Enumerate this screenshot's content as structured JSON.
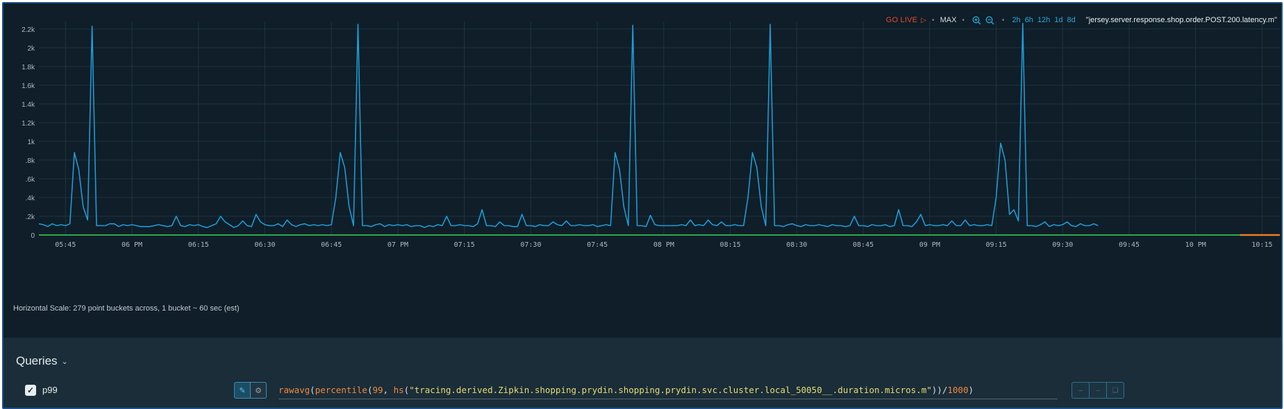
{
  "toolbar": {
    "go_live": "GO LIVE",
    "max": "MAX",
    "zoom_in_icon": "zoom-in-icon",
    "zoom_out_icon": "zoom-out-icon",
    "ranges": [
      "2h",
      "6h",
      "12h",
      "1d",
      "8d"
    ],
    "metric_name": "\"jersey.server.response.shop.order.POST.200.latency.m\""
  },
  "scale_text": "Horizontal Scale: 279 point buckets across, 1 bucket ~ 60 sec (est)",
  "queries": {
    "title": "Queries",
    "row": {
      "checked": true,
      "name": "p99",
      "parts": [
        {
          "t": "rawavg",
          "c": "fn"
        },
        {
          "t": "(",
          "c": "punct"
        },
        {
          "t": "percentile",
          "c": "fn"
        },
        {
          "t": "(",
          "c": "punct"
        },
        {
          "t": "99",
          "c": "num"
        },
        {
          "t": ", ",
          "c": "punct"
        },
        {
          "t": "hs",
          "c": "fn"
        },
        {
          "t": "(",
          "c": "punct"
        },
        {
          "t": "\"tracing.derived.Zipkin.shopping.prydin.shopping.prydin.svc.cluster.local_50050__.duration.micros.m\"",
          "c": "str"
        },
        {
          "t": "))",
          "c": "punct"
        },
        {
          "t": "/",
          "c": "op"
        },
        {
          "t": "1000",
          "c": "num"
        },
        {
          "t": ")",
          "c": "punct"
        }
      ]
    }
  },
  "colors": {
    "background": "#0f1e28",
    "series": "#1f9ad6",
    "zero_line": "#2ea84a",
    "future_marker": "#f07a22",
    "go_live": "#e5492f",
    "accent": "#26a8d8"
  },
  "chart_data": {
    "type": "line",
    "title": "",
    "xlabel": "",
    "ylabel": "",
    "x_tick_labels": [
      "05:45",
      "06 PM",
      "06:15",
      "06:30",
      "06:45",
      "07 PM",
      "07:15",
      "07:30",
      "07:45",
      "08 PM",
      "08:15",
      "08:30",
      "08:45",
      "09 PM",
      "09:15",
      "09:30",
      "09:45",
      "10 PM",
      "10:15"
    ],
    "x_tick_minutes": [
      345,
      360,
      375,
      390,
      405,
      420,
      435,
      450,
      465,
      480,
      495,
      510,
      525,
      540,
      555,
      570,
      585,
      600,
      615
    ],
    "xlim_minutes": [
      339,
      619
    ],
    "y_tick_labels": [
      "0",
      ".2k",
      ".4k",
      ".6k",
      ".8k",
      "1k",
      "1.2k",
      "1.4k",
      "1.6k",
      "1.8k",
      "2k",
      "2.2k"
    ],
    "y_ticks": [
      0,
      200,
      400,
      600,
      800,
      1000,
      1200,
      1400,
      1600,
      1800,
      2000,
      2200
    ],
    "ylim": [
      0,
      2280
    ],
    "grid": true,
    "baseline_value": 0,
    "future_marker_minutes": [
      610,
      619
    ],
    "series": [
      {
        "x_minutes": [
          339,
          340,
          341,
          342,
          343,
          344,
          345,
          346,
          347,
          348,
          349,
          350,
          351,
          352,
          353,
          354,
          355,
          356,
          357,
          358,
          359,
          360,
          361,
          362,
          363,
          364,
          365,
          366,
          367,
          368,
          369,
          370,
          371,
          372,
          373,
          374,
          375,
          376,
          377,
          378,
          379,
          380,
          381,
          382,
          383,
          384,
          385,
          386,
          387,
          388,
          389,
          390,
          391,
          392,
          393,
          394,
          395,
          396,
          397,
          398,
          399,
          400,
          401,
          402,
          403,
          404,
          405,
          406,
          407,
          408,
          409,
          410,
          411,
          412,
          413,
          414,
          415,
          416,
          417,
          418,
          419,
          420,
          421,
          422,
          423,
          424,
          425,
          426,
          427,
          428,
          429,
          430,
          431,
          432,
          433,
          434,
          435,
          436,
          437,
          438,
          439,
          440,
          441,
          442,
          443,
          444,
          445,
          446,
          447,
          448,
          449,
          450,
          451,
          452,
          453,
          454,
          455,
          456,
          457,
          458,
          459,
          460,
          461,
          462,
          463,
          464,
          465,
          466,
          467,
          468,
          469,
          470,
          471,
          472,
          473,
          474,
          475,
          476,
          477,
          478,
          479,
          480,
          481,
          482,
          483,
          484,
          485,
          486,
          487,
          488,
          489,
          490,
          491,
          492,
          493,
          494,
          495,
          496,
          497,
          498,
          499,
          500,
          501,
          502,
          503,
          504,
          505,
          506,
          507,
          508,
          509,
          510,
          511,
          512,
          513,
          514,
          515,
          516,
          517,
          518,
          519,
          520,
          521,
          522,
          523,
          524,
          525,
          526,
          527,
          528,
          529,
          530,
          531,
          532,
          533,
          534,
          535,
          536,
          537,
          538,
          539,
          540,
          541,
          542,
          543,
          544,
          545,
          546,
          547,
          548,
          549,
          550,
          551,
          552,
          553,
          554,
          555,
          556,
          557,
          558,
          559,
          560,
          561,
          562,
          563,
          564,
          565,
          566,
          567,
          568,
          569,
          570,
          571,
          572,
          573,
          574,
          575,
          576,
          577,
          578,
          579,
          580
        ],
        "values": [
          120,
          110,
          90,
          120,
          100,
          110,
          100,
          120,
          880,
          700,
          300,
          160,
          2230,
          100,
          100,
          100,
          120,
          120,
          90,
          110,
          100,
          110,
          100,
          90,
          90,
          90,
          100,
          110,
          100,
          90,
          100,
          200,
          100,
          90,
          110,
          100,
          110,
          90,
          80,
          100,
          120,
          200,
          140,
          110,
          80,
          100,
          150,
          100,
          90,
          220,
          140,
          110,
          100,
          100,
          120,
          90,
          160,
          110,
          90,
          110,
          120,
          100,
          110,
          100,
          110,
          100,
          110,
          400,
          880,
          720,
          300,
          100,
          2250,
          100,
          100,
          90,
          110,
          120,
          90,
          110,
          100,
          110,
          100,
          110,
          90,
          100,
          100,
          80,
          100,
          90,
          110,
          100,
          200,
          100,
          100,
          110,
          100,
          100,
          90,
          120,
          270,
          100,
          100,
          90,
          140,
          100,
          100,
          90,
          90,
          220,
          100,
          100,
          90,
          110,
          100,
          100,
          140,
          110,
          100,
          150,
          100,
          100,
          110,
          100,
          100,
          110,
          90,
          100,
          110,
          100,
          880,
          700,
          300,
          100,
          2240,
          100,
          100,
          90,
          210,
          110,
          100,
          100,
          100,
          100,
          100,
          110,
          100,
          160,
          100,
          110,
          100,
          160,
          110,
          100,
          140,
          100,
          100,
          110,
          100,
          100,
          400,
          880,
          720,
          300,
          100,
          2250,
          100,
          100,
          90,
          110,
          120,
          100,
          90,
          110,
          100,
          100,
          110,
          100,
          90,
          110,
          100,
          100,
          90,
          100,
          200,
          100,
          100,
          90,
          110,
          100,
          100,
          110,
          90,
          100,
          270,
          100,
          100,
          90,
          140,
          220,
          100,
          110,
          100,
          100,
          110,
          100,
          150,
          100,
          100,
          160,
          100,
          110,
          100,
          100,
          110,
          100,
          400,
          980,
          800,
          220,
          270,
          150,
          2260,
          100,
          100,
          90,
          110,
          140,
          90,
          110,
          100,
          110,
          140,
          100,
          90,
          120,
          100,
          100,
          120,
          100
        ]
      }
    ]
  }
}
